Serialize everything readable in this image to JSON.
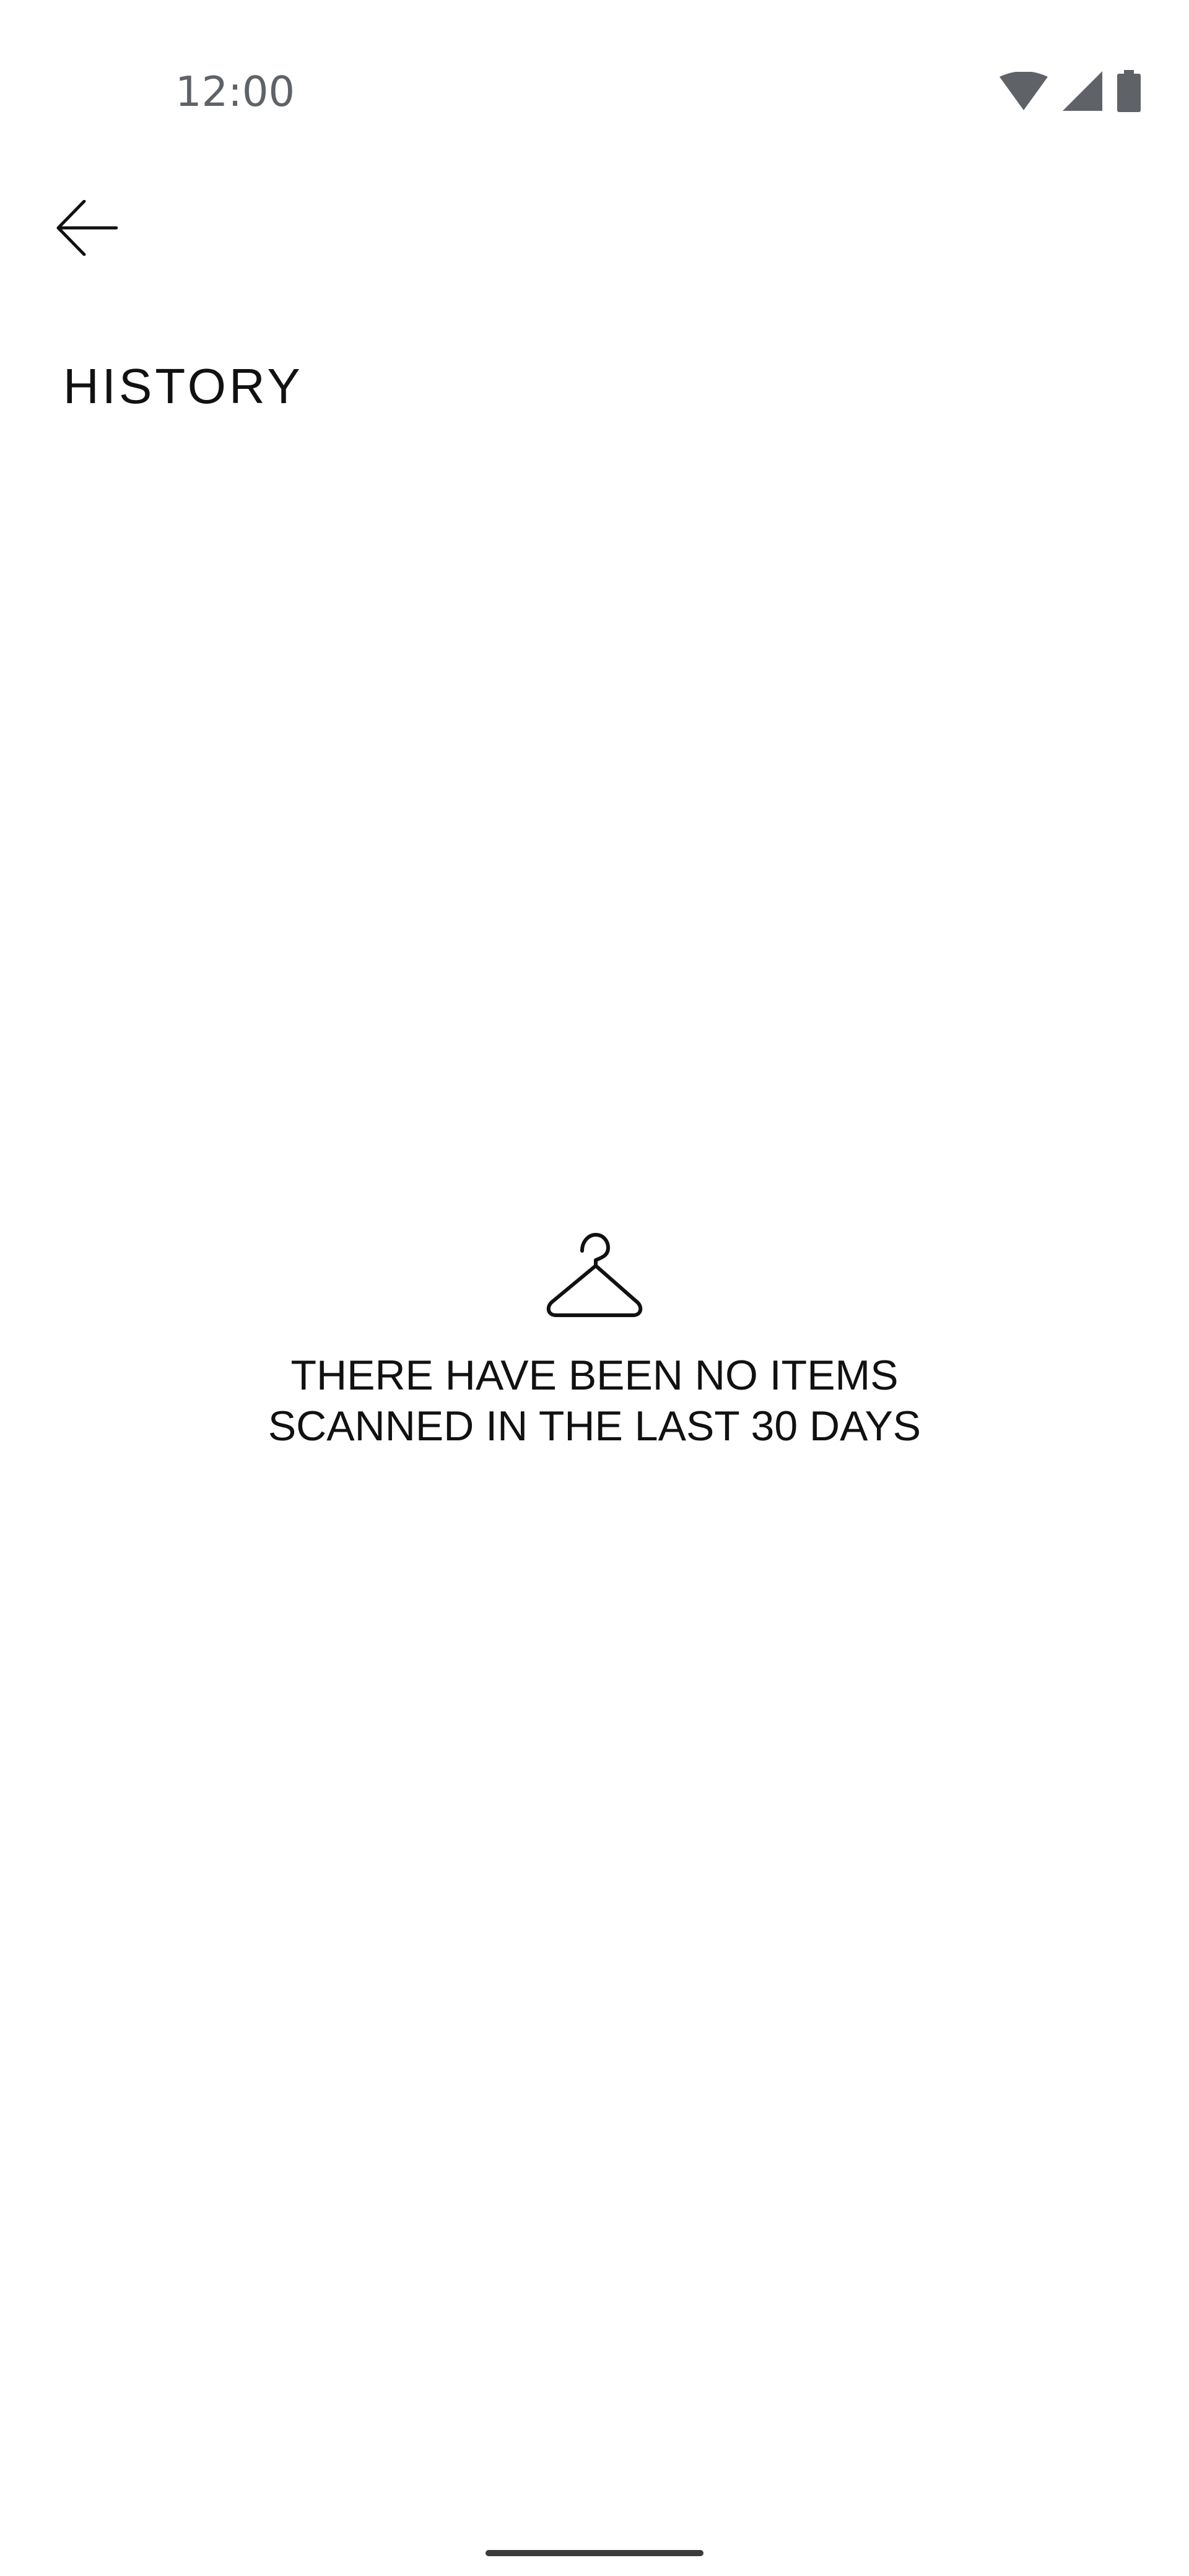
{
  "status_bar": {
    "time": "12:00",
    "icons": [
      "wifi-icon",
      "cellular-signal-icon",
      "battery-icon"
    ]
  },
  "header": {
    "back_icon": "arrow-left-icon",
    "title": "HISTORY"
  },
  "empty_state": {
    "icon": "hanger-icon",
    "message_line_1": "THERE HAVE BEEN NO ITEMS",
    "message_line_2": "SCANNED IN THE LAST 30 DAYS"
  },
  "colors": {
    "background": "#ffffff",
    "text": "#111111",
    "status_text": "#5f6368"
  }
}
